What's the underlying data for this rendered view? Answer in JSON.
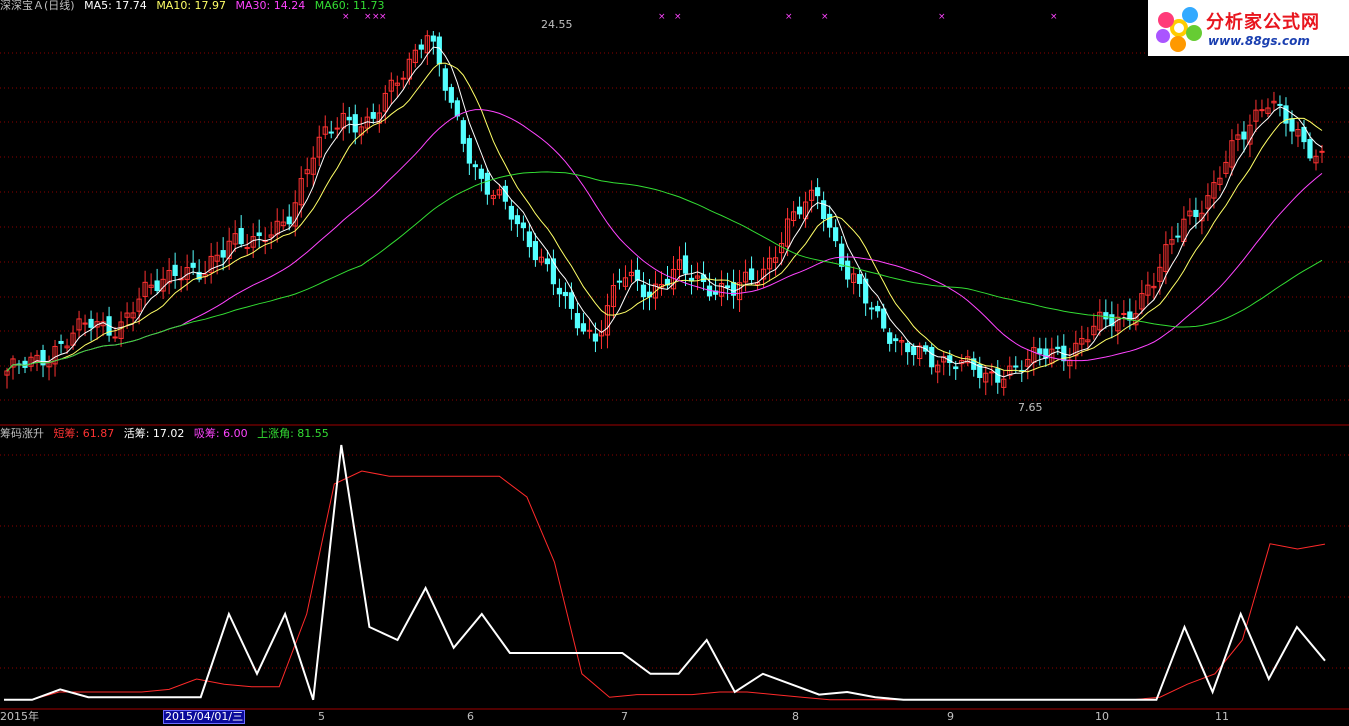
{
  "price_panel": {
    "title": "深深宝Ａ(日线)",
    "indicators": [
      {
        "label": "MA5: 17.74",
        "color": "#ffffff"
      },
      {
        "label": "MA10: 17.97",
        "color": "#ffff66"
      },
      {
        "label": "MA30: 14.24",
        "color": "#ff44ff"
      },
      {
        "label": "MA60: 11.73",
        "color": "#33dd33"
      }
    ],
    "high_label": "24.55",
    "low_label": "7.65"
  },
  "indicator_panel": {
    "title": "筹码涨升",
    "items": [
      {
        "label": "短筹: 61.87",
        "color": "#ff3333"
      },
      {
        "label": "活筹: 17.02",
        "color": "#ffffff"
      },
      {
        "label": "吸筹: 6.00",
        "color": "#ff44ff"
      },
      {
        "label": "上涨角: 81.55",
        "color": "#33dd33"
      }
    ]
  },
  "logo": {
    "title": "分析家公式网",
    "url": "www.88gs.com"
  },
  "x_axis": {
    "labels": [
      "2015年",
      "2015/04/01/三",
      "5",
      "6",
      "7",
      "8",
      "9",
      "10",
      "11"
    ],
    "selected_label": "2015/04/01/三"
  },
  "colors": {
    "up": "#ff3232",
    "down": "#54ffff",
    "ma5": "#ffffff",
    "ma10": "#ffff66",
    "ma30": "#ff44ff",
    "ma60": "#33dd33",
    "grid": "#8b0000",
    "short": "#ff2a2a",
    "active": "#ffffff"
  },
  "chart_data": {
    "type": "line",
    "price": {
      "high": 24.55,
      "low": 7.65,
      "close_series": [
        8.2,
        8.6,
        9.6,
        10.5,
        10.3,
        12.0,
        13.2,
        12.6,
        14.8,
        14.2,
        15.6,
        18.8,
        20.5,
        20.0,
        22.4,
        24.55,
        20.5,
        17.2,
        15.8,
        13.9,
        11.2,
        9.8,
        12.8,
        12.1,
        13.0,
        12.4,
        12.0,
        13.0,
        15.4,
        16.8,
        12.9,
        11.0,
        9.4,
        8.6,
        8.9,
        7.65,
        8.5,
        8.9,
        9.2,
        10.4,
        10.9,
        12.4,
        15.6,
        16.4,
        19.6,
        21.2,
        19.8,
        18.5
      ]
    },
    "indicators": {
      "short_chip": [
        2,
        2,
        5,
        5,
        5,
        5,
        6,
        10,
        8,
        7,
        7,
        35,
        85,
        90,
        88,
        88,
        88,
        88,
        88,
        80,
        55,
        12,
        3,
        4,
        4,
        4,
        5,
        5,
        4,
        3,
        2,
        2,
        2,
        2,
        2,
        2,
        2,
        2,
        2,
        2,
        2,
        2,
        3,
        8,
        12,
        25,
        62,
        60,
        61.87
      ],
      "active_chip": [
        2,
        2,
        6,
        3,
        3,
        3,
        3,
        3,
        35,
        12,
        35,
        2,
        100,
        30,
        25,
        45,
        22,
        35,
        20,
        20,
        20,
        20,
        20,
        12,
        12,
        25,
        5,
        12,
        8,
        4,
        5,
        3,
        2,
        2,
        2,
        2,
        2,
        2,
        2,
        2,
        2,
        2,
        30,
        5,
        35,
        10,
        30,
        17.02
      ]
    }
  }
}
